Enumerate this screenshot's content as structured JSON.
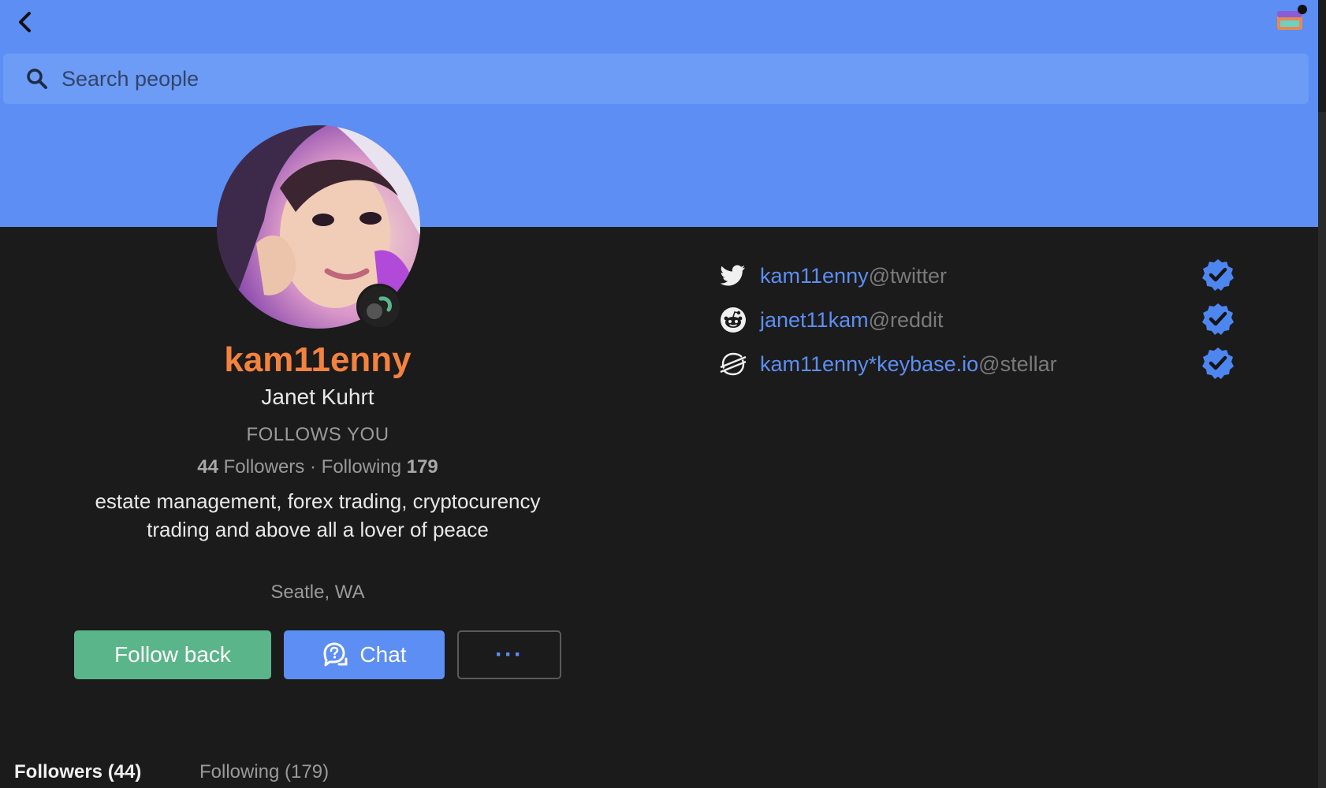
{
  "header": {
    "back_icon": "chevron-left-icon",
    "app_icon": "keybase-app-icon",
    "banner_color": "#5c8ef4"
  },
  "search": {
    "placeholder": "Search people",
    "value": ""
  },
  "profile": {
    "username": "kam11enny",
    "full_name": "Janet Kuhrt",
    "follows_you": "FOLLOWS YOU",
    "followers_count": "44",
    "followers_label": "Followers",
    "separator": "·",
    "following_label": "Following",
    "following_count": "179",
    "bio": "estate management, forex trading, cryptocurency trading and above all a lover of peace",
    "location": "Seatle, WA",
    "username_color": "#f3823f"
  },
  "actions": {
    "follow_label": "Follow back",
    "chat_label": "Chat",
    "more_label": "···"
  },
  "proofs": [
    {
      "icon": "twitter-icon",
      "user": "kam11enny",
      "service": "@twitter",
      "verified": true
    },
    {
      "icon": "reddit-icon",
      "user": "janet11kam",
      "service": "@reddit",
      "verified": true
    },
    {
      "icon": "stellar-icon",
      "user": "kam11enny*keybase.io",
      "service": "@stellar",
      "verified": true
    }
  ],
  "tabs": [
    {
      "label": "Followers (44)",
      "active": true
    },
    {
      "label": "Following (179)",
      "active": false
    }
  ]
}
